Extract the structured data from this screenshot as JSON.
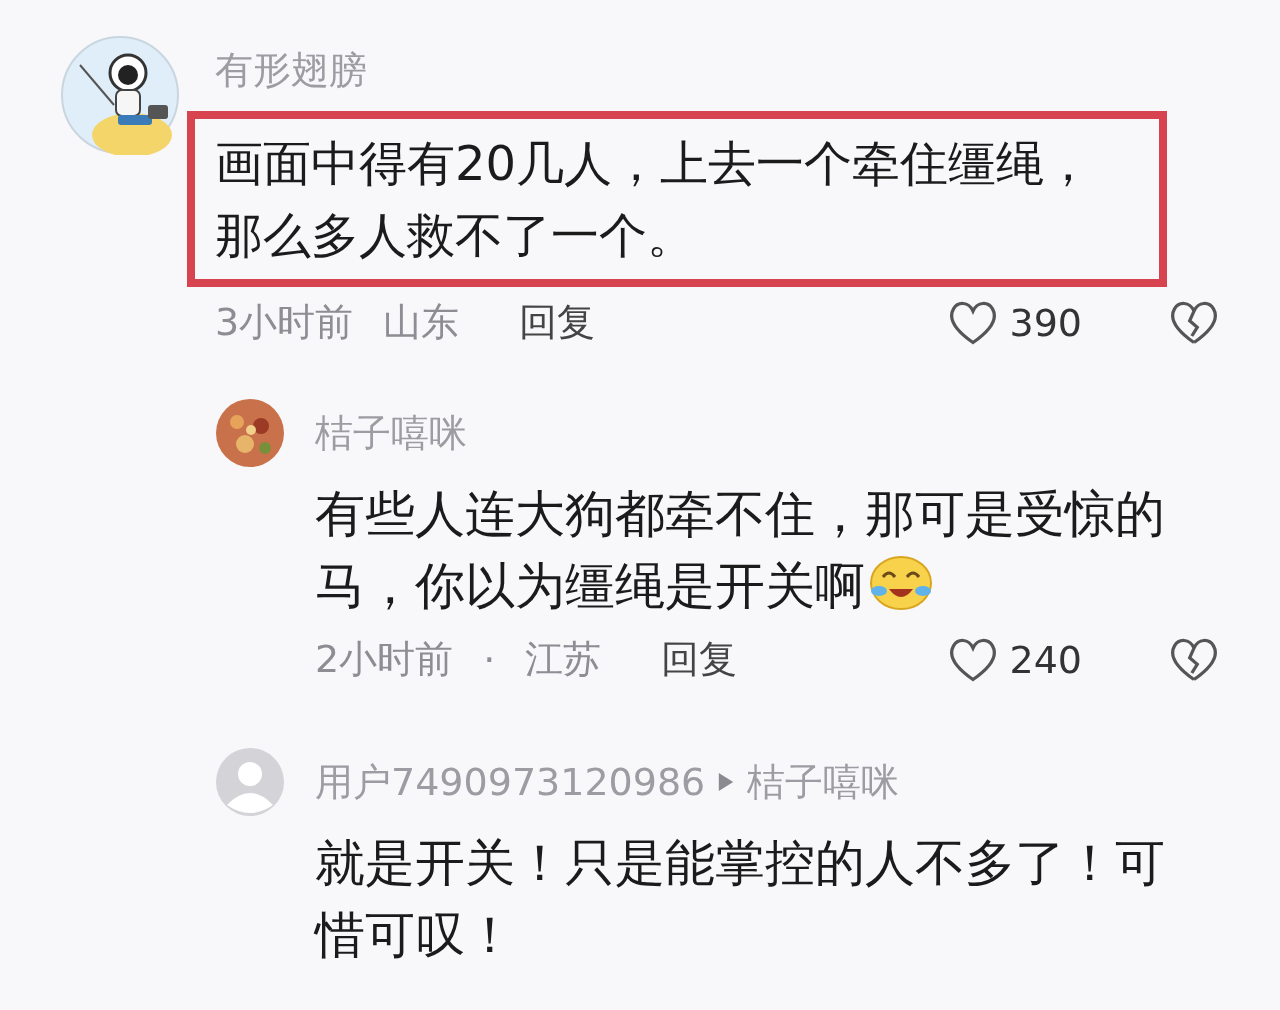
{
  "comments": [
    {
      "kind": "top",
      "author": "有形翅膀",
      "text": "画面中得有20几人，上去一个牵住缰绳，那么多人救不了一个。",
      "time": "3小时前",
      "location": "山东",
      "reply": "回复",
      "likes": "390",
      "highlighted": true
    },
    {
      "kind": "reply",
      "author": "桔子嘻咪",
      "text": "有些人连大狗都牵不住，那可是受惊的马，你以为缰绳是开关啊",
      "time": "2小时前",
      "separator": "·",
      "location": "江苏",
      "reply": "回复",
      "likes": "240",
      "highlighted": false
    },
    {
      "kind": "reply",
      "author": "用户7490973120986",
      "reply_to": "桔子嘻咪",
      "text": "就是开关！只是能掌控的人不多了！可惜可叹！",
      "highlighted": false
    }
  ]
}
